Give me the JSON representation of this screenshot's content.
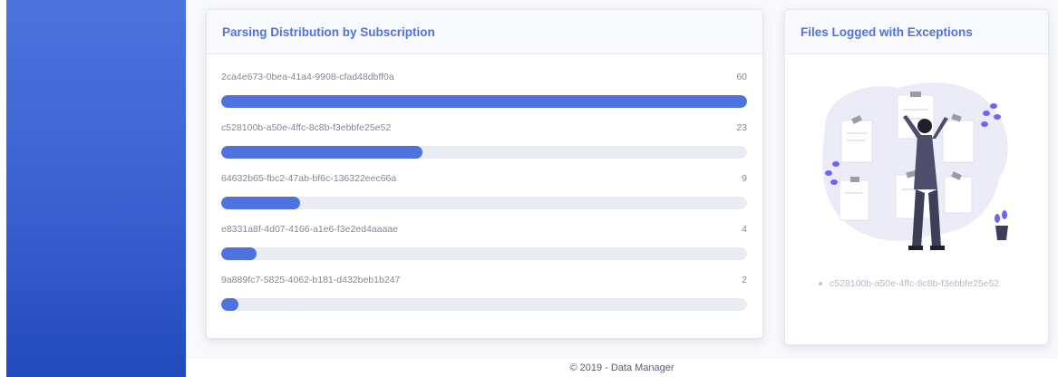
{
  "colors": {
    "accent": "#4e73df",
    "sidebar": "#4e73df",
    "track": "#eaecf4"
  },
  "distribution": {
    "title": "Parsing Distribution by Subscription",
    "items": [
      {
        "id": "2ca4e673-0bea-41a4-9908-cfad48dbff0a",
        "count": "60",
        "fraction": 1.0
      },
      {
        "id": "c528100b-a50e-4ffc-8c8b-f3ebbfe25e52",
        "count": "23",
        "fraction": 0.383
      },
      {
        "id": "64632b65-fbc2-47ab-bf6c-136322eec66a",
        "count": "9",
        "fraction": 0.15
      },
      {
        "id": "e8331a8f-4d07-4166-a1e6-f3e2ed4aaaae",
        "count": "4",
        "fraction": 0.067
      },
      {
        "id": "9a889fc7-5825-4062-b181-d432beb1b247",
        "count": "2",
        "fraction": 0.033
      }
    ]
  },
  "exceptions": {
    "title": "Files Logged with Exceptions",
    "illustration_icon": "person-reviewing-documents-illustration",
    "files": [
      "c528100b-a50e-4ffc-8c8b-f3ebbfe25e52"
    ]
  },
  "footer": {
    "text": "© 2019 - Data Manager"
  }
}
